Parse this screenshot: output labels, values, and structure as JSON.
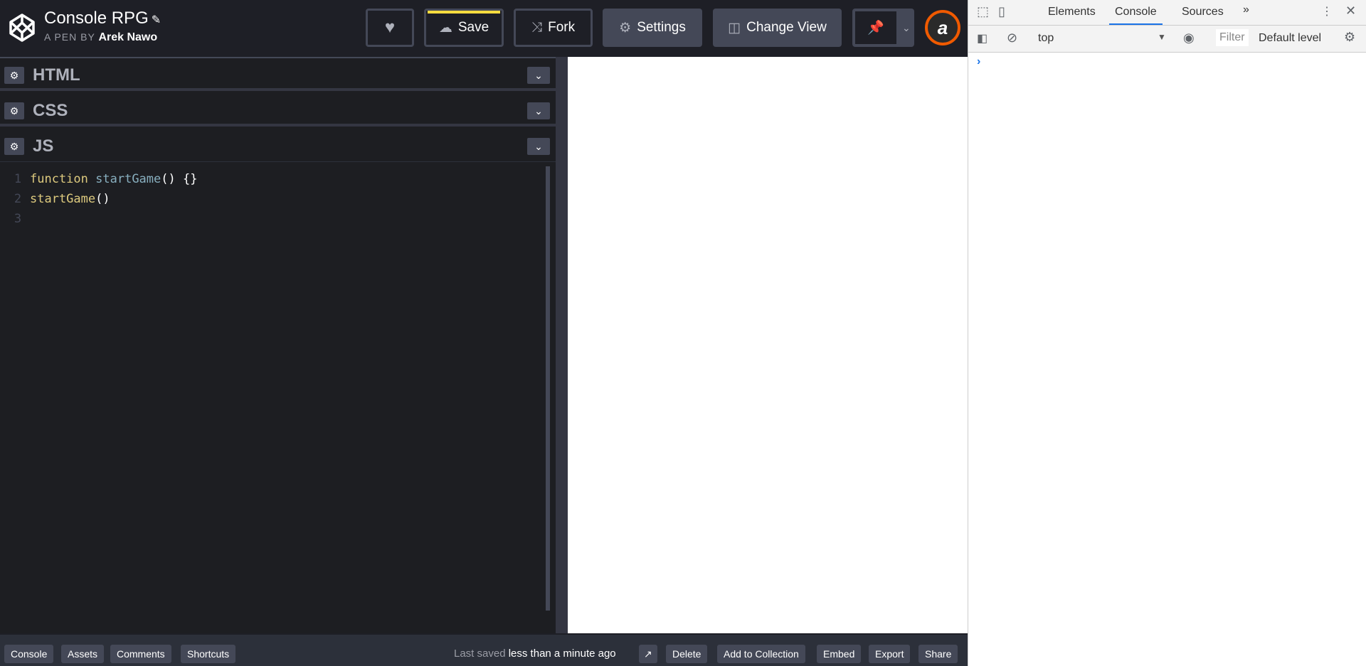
{
  "header": {
    "title": "Console RPG",
    "byline_prefix": "A PEN BY",
    "author": "Arek Nawo",
    "buttons": {
      "save": "Save",
      "fork": "Fork",
      "settings": "Settings",
      "change_view": "Change View"
    },
    "avatar_letter": "a"
  },
  "panels": [
    {
      "name": "HTML"
    },
    {
      "name": "CSS"
    },
    {
      "name": "JS"
    }
  ],
  "code": {
    "lines": [
      {
        "num": "1",
        "kw": "function",
        "fn": "startGame",
        "rest": "() {}"
      },
      {
        "num": "2",
        "fn2": "startGame",
        "rest": "()"
      },
      {
        "num": "3"
      }
    ]
  },
  "footer": {
    "left": [
      "Console",
      "Assets",
      "Comments",
      "Shortcuts"
    ],
    "saved_prefix": "Last saved",
    "saved_time": "less than a minute ago",
    "right": [
      "Delete",
      "Add to Collection",
      "Embed",
      "Export",
      "Share"
    ]
  },
  "devtools": {
    "tabs": [
      "Elements",
      "Console",
      "Sources"
    ],
    "more": "»",
    "context": "top",
    "filter_placeholder": "Filter",
    "level": "Default level",
    "prompt": "›"
  },
  "colors": {
    "accent": "#ffdd40",
    "devtools_accent": "#1a73e8"
  }
}
